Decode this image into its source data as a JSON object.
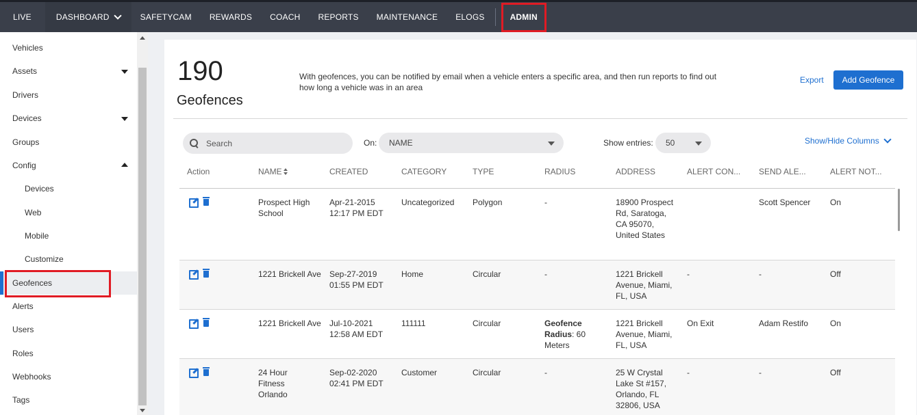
{
  "topnav": {
    "items": [
      "LIVE",
      "DASHBOARD",
      "SAFETYCAM",
      "REWARDS",
      "COACH",
      "REPORTS",
      "MAINTENANCE",
      "ELOGS",
      "ADMIN"
    ]
  },
  "sidebar": {
    "items": [
      {
        "label": "Vehicles"
      },
      {
        "label": "Assets"
      },
      {
        "label": "Drivers"
      },
      {
        "label": "Devices"
      },
      {
        "label": "Groups"
      },
      {
        "label": "Config"
      },
      {
        "label": "Devices"
      },
      {
        "label": "Web"
      },
      {
        "label": "Mobile"
      },
      {
        "label": "Customize"
      },
      {
        "label": "Geofences"
      },
      {
        "label": "Alerts"
      },
      {
        "label": "Users"
      },
      {
        "label": "Roles"
      },
      {
        "label": "Webhooks"
      },
      {
        "label": "Tags"
      }
    ]
  },
  "header": {
    "count": "190",
    "title": "Geofences",
    "description": "With geofences, you can be notified by email when a vehicle enters a specific area, and then run reports to find out how long a vehicle was in an area",
    "export_label": "Export",
    "add_label": "Add Geofence"
  },
  "controls": {
    "search_placeholder": "Search",
    "on_label": "On:",
    "on_value": "NAME",
    "entries_label": "Show entries:",
    "entries_value": "50",
    "show_hide_label": "Show/Hide Columns"
  },
  "table": {
    "columns": [
      "Action",
      "NAME",
      "CREATED",
      "CATEGORY",
      "TYPE",
      "RADIUS",
      "ADDRESS",
      "ALERT CON...",
      "SEND ALE...",
      "ALERT NOT..."
    ],
    "rows": [
      {
        "name": "Prospect High School",
        "created": "Apr-21-2015 12:17 PM EDT",
        "category": "Uncategorized",
        "type": "Polygon",
        "radius_label": "",
        "radius": "-",
        "address": "18900 Prospect Rd, Saratoga, CA 95070, United States",
        "alert_con": "",
        "send_ale": "Scott Spencer",
        "alert_not": "On"
      },
      {
        "name": "1221 Brickell Ave",
        "created": "Sep-27-2019 01:55 PM EDT",
        "category": "Home",
        "type": "Circular",
        "radius_label": "",
        "radius": "-",
        "address": "1221 Brickell Avenue, Miami, FL, USA",
        "alert_con": "-",
        "send_ale": "-",
        "alert_not": "Off"
      },
      {
        "name": "1221 Brickell Ave",
        "created": "Jul-10-2021 12:58 AM EDT",
        "category": "111111",
        "type": "Circular",
        "radius_label": "Geofence Radius",
        "radius": ": 60 Meters",
        "address": "1221 Brickell Avenue, Miami, FL, USA",
        "alert_con": "On Exit",
        "send_ale": "Adam Restifo",
        "alert_not": "On"
      },
      {
        "name": "24 Hour Fitness Orlando",
        "created": "Sep-02-2020 02:41 PM EDT",
        "category": "Customer",
        "type": "Circular",
        "radius_label": "",
        "radius": "-",
        "address": "25 W Crystal Lake St #157, Orlando, FL 32806, USA",
        "alert_con": "-",
        "send_ale": "-",
        "alert_not": "Off"
      }
    ]
  },
  "colors": {
    "nav_bg": "#3a3f4a",
    "accent": "#1e6fd0",
    "highlight": "#e01b24"
  }
}
